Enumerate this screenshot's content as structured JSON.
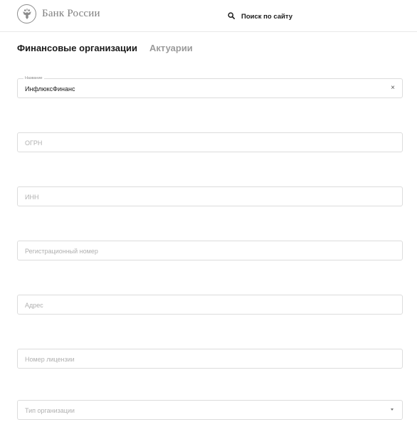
{
  "header": {
    "logo_text": "Банк России",
    "logo_icon": "double-eagle-emblem-icon",
    "search_label": "Поиск по сайту",
    "search_icon": "search-icon"
  },
  "tabs": [
    {
      "label": "Финансовые организации",
      "active": true
    },
    {
      "label": "Актуарии",
      "active": false
    }
  ],
  "form": {
    "name": {
      "label": "Название",
      "value": "ИнфлюксФинанс",
      "clear_icon": "×"
    },
    "ogrn": {
      "placeholder": "ОГРН"
    },
    "inn": {
      "placeholder": "ИНН"
    },
    "reg_number": {
      "placeholder": "Регистрационный номер"
    },
    "address": {
      "placeholder": "Адрес"
    },
    "license": {
      "placeholder": "Номер лицензии"
    },
    "org_type": {
      "placeholder": "Тип организации"
    }
  },
  "colors": {
    "active_tab": "#1a1a1a",
    "inactive_tab": "#9b9b9b",
    "field_border": "#dcdcdc",
    "placeholder": "#b0b0b0"
  }
}
